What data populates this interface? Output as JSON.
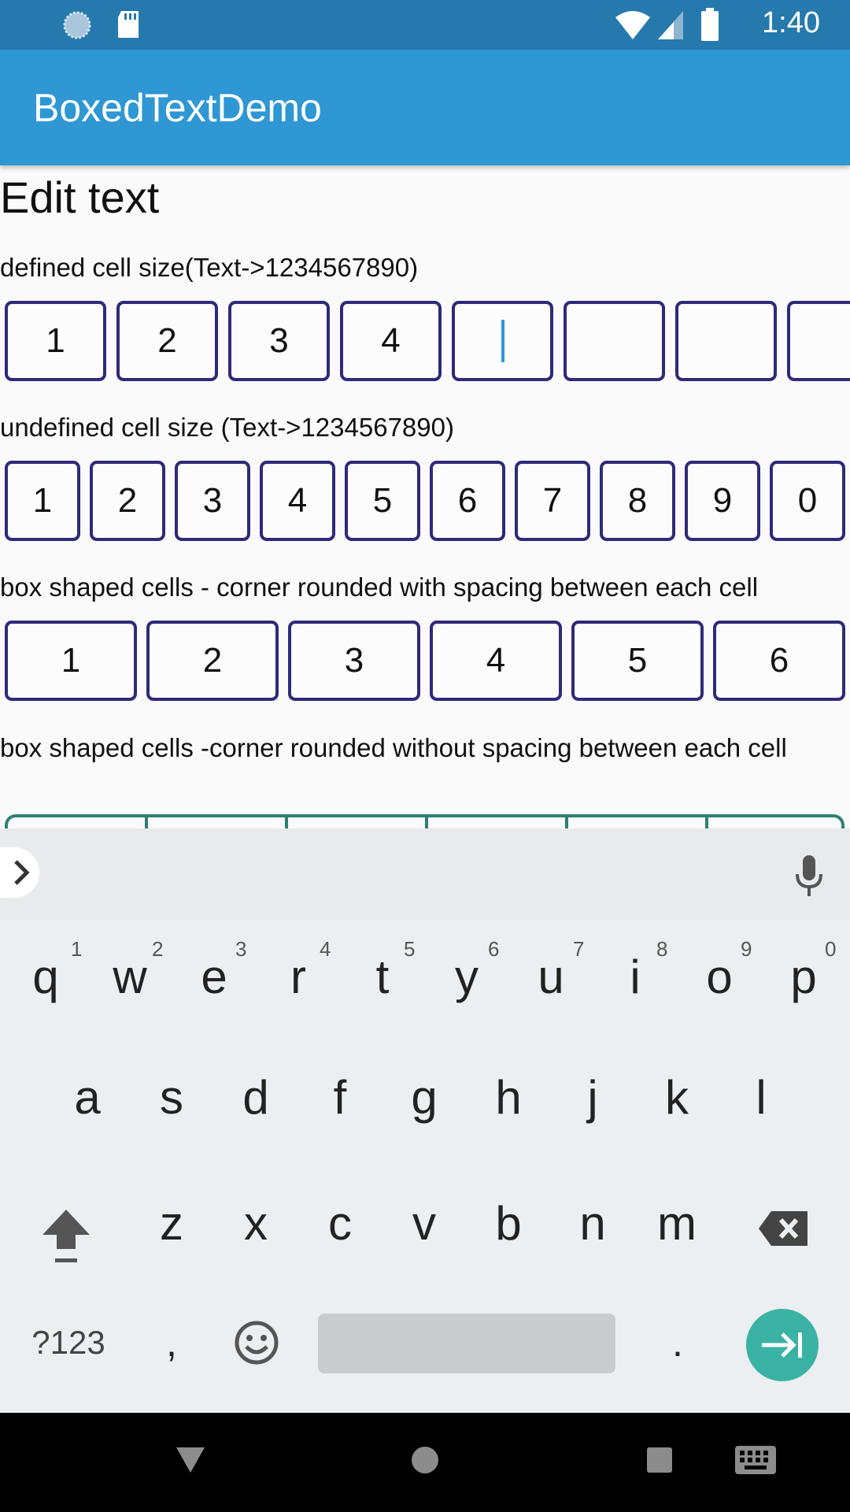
{
  "status": {
    "time": "1:40"
  },
  "app": {
    "title": "BoxedTextDemo"
  },
  "page": {
    "title": "Edit text"
  },
  "sections": {
    "defined": {
      "label": "defined cell size(Text->1234567890)",
      "cells": [
        "1",
        "2",
        "3",
        "4",
        "",
        "",
        "",
        ""
      ]
    },
    "undefined": {
      "label": "undefined cell size (Text->1234567890)",
      "cells": [
        "1",
        "2",
        "3",
        "4",
        "5",
        "6",
        "7",
        "8",
        "9",
        "0"
      ]
    },
    "spaced": {
      "label": "box shaped cells - corner rounded with spacing between each cell",
      "cells": [
        "1",
        "2",
        "3",
        "4",
        "5",
        "6"
      ]
    },
    "nospace": {
      "label": "box shaped cells -corner rounded without spacing between each cell"
    }
  },
  "keyboard": {
    "row1": [
      "q",
      "w",
      "e",
      "r",
      "t",
      "y",
      "u",
      "i",
      "o",
      "p"
    ],
    "row1_hints": [
      "1",
      "2",
      "3",
      "4",
      "5",
      "6",
      "7",
      "8",
      "9",
      "0"
    ],
    "row2": [
      "a",
      "s",
      "d",
      "f",
      "g",
      "h",
      "j",
      "k",
      "l"
    ],
    "row3": [
      "z",
      "x",
      "c",
      "v",
      "b",
      "n",
      "m"
    ],
    "symbols": "?123",
    "comma": ",",
    "period": "."
  },
  "colors": {
    "accent": "#2e97d4",
    "cell_border": "#2f2a78",
    "teal": "#2d8071",
    "enter": "#3ab3a4"
  }
}
